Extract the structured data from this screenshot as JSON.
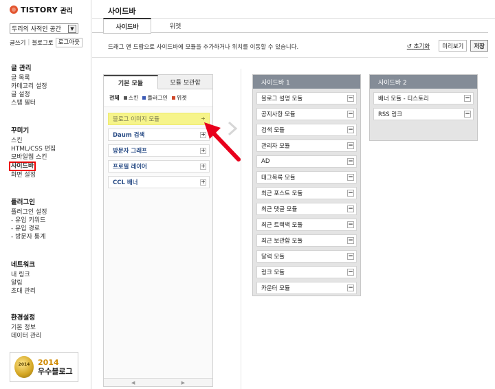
{
  "app": {
    "logo_text": "TISTORY",
    "logo_sub": "관리"
  },
  "left_nav": {
    "blog_select": "두리의 사적인 공간",
    "quick_links": [
      "글쓰기",
      "블로그로"
    ],
    "logout_label": "로그아웃",
    "groups": [
      {
        "title": "글 관리",
        "items": [
          "글 목록",
          "카테고리 설정",
          "글 설정",
          "스팸 필터"
        ]
      },
      {
        "title": "꾸미기",
        "items": [
          "스킨",
          "HTML/CSS 편집",
          "모바일웹 스킨",
          "사이드바",
          "화면 설정"
        ]
      },
      {
        "title": "플러그인",
        "items": [
          "플러그인 설정",
          "- 유입 키워드",
          "- 유입 경로",
          "- 방문자 통계"
        ]
      },
      {
        "title": "네트워크",
        "items": [
          "내 링크",
          "알림",
          "초대 관리"
        ]
      },
      {
        "title": "환경설정",
        "items": [
          "기본 정보",
          "데이터 관리"
        ]
      }
    ],
    "badge": {
      "medal_text": "2014",
      "year": "2014",
      "label": "우수블로그"
    }
  },
  "header": {
    "title": "사이드바",
    "tabs": [
      "사이드바",
      "위젯"
    ],
    "description": "드래그 앤 드랍으로 사이드바에 모듈을 추가하거나 위치를 이동할 수 있습니다.",
    "reset_label": "초기화",
    "preview_label": "미리보기",
    "save_label": "저장"
  },
  "module_panel": {
    "tabs": [
      "기본 모듈",
      "모듈 보관함"
    ],
    "filters": {
      "all": "전체",
      "skin": "스킨",
      "plugin": "플러그인",
      "widget": "위젯"
    },
    "filter_colors": {
      "skin": "#555555",
      "plugin": "#3b5ab5",
      "widget": "#d0482a"
    },
    "modules": [
      "블로그 이미지 모듈",
      "Daum 검색",
      "방문자 그래프",
      "프로필 레이어",
      "CCL 배너"
    ]
  },
  "sidebar1": {
    "title": "사이드바 1",
    "items": [
      "블로그 설명 모듈",
      "공지사항 모듈",
      "검색 모듈",
      "관리자 모듈",
      "AD",
      "태그목록 모듈",
      "최근 포스트 모듈",
      "최근 댓글 모듈",
      "최근 트랙백 모듈",
      "최근 보관함 모듈",
      "달력 모듈",
      "링크 모듈",
      "카운터 모듈"
    ]
  },
  "sidebar2": {
    "title": "사이드바 2",
    "items": [
      "배너 모듈 - 티스토리",
      "RSS 링크"
    ]
  },
  "colors": {
    "highlight": "#f6f48a",
    "sidebar_header": "#848c97",
    "annotation": "#e8001c",
    "logo": "#e3552f"
  }
}
